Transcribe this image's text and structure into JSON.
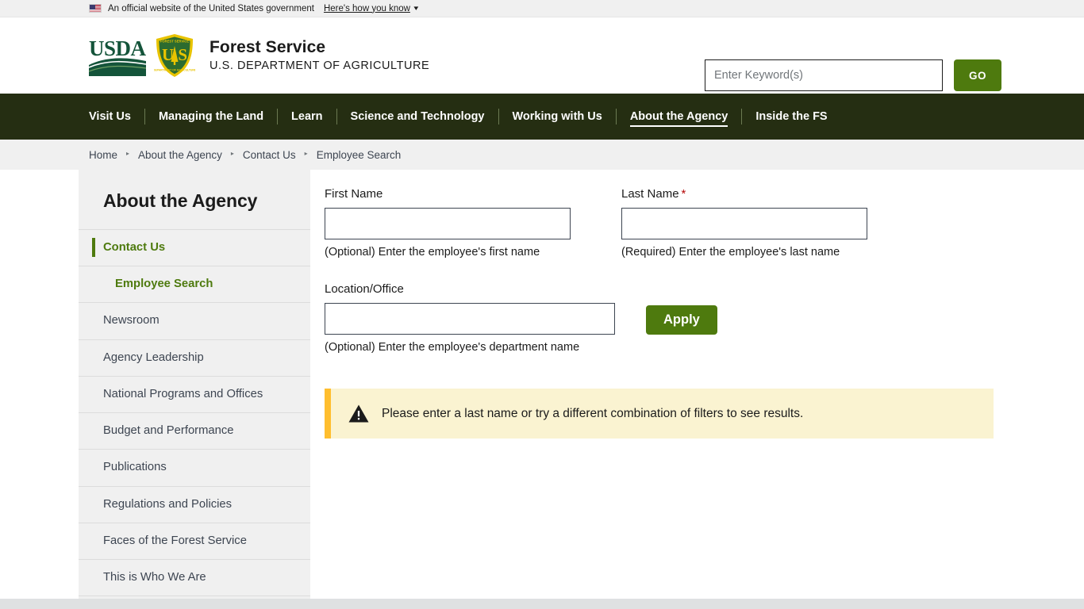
{
  "usa_banner": {
    "text": "An official website of the United States government",
    "link_label": "Here's how you know",
    "flag_icon": "us-flag-icon",
    "caret_icon": "chevron-down-icon"
  },
  "header": {
    "usda_logo": "usda-logo",
    "fs_shield": "forest-service-shield-icon",
    "title": "Forest Service",
    "subtitle": "U.S. DEPARTMENT OF AGRICULTURE",
    "search": {
      "placeholder": "Enter Keyword(s)",
      "value": "",
      "button_label": "GO"
    }
  },
  "nav": {
    "items": [
      {
        "label": "Visit Us",
        "active": false
      },
      {
        "label": "Managing the Land",
        "active": false
      },
      {
        "label": "Learn",
        "active": false
      },
      {
        "label": "Science and Technology",
        "active": false
      },
      {
        "label": "Working with Us",
        "active": false
      },
      {
        "label": "About the Agency",
        "active": true
      },
      {
        "label": "Inside the FS",
        "active": false
      }
    ]
  },
  "breadcrumb": {
    "separator": "▸",
    "items": [
      {
        "label": "Home"
      },
      {
        "label": "About the Agency"
      },
      {
        "label": "Contact Us"
      },
      {
        "label": "Employee Search"
      }
    ]
  },
  "sidebar": {
    "title": "About the Agency",
    "items": [
      {
        "label": "Contact Us",
        "state": "active"
      },
      {
        "label": "Employee Search",
        "state": "sub"
      },
      {
        "label": "Newsroom",
        "state": "normal"
      },
      {
        "label": "Agency Leadership",
        "state": "normal"
      },
      {
        "label": "National Programs and Offices",
        "state": "normal"
      },
      {
        "label": "Budget and Performance",
        "state": "normal"
      },
      {
        "label": "Publications",
        "state": "normal"
      },
      {
        "label": "Regulations and Policies",
        "state": "normal"
      },
      {
        "label": "Faces of the Forest Service",
        "state": "normal"
      },
      {
        "label": "This is Who We Are",
        "state": "normal"
      }
    ]
  },
  "form": {
    "first_name": {
      "label": "First Name",
      "value": "",
      "placeholder": "",
      "hint": "(Optional) Enter the employee's first name"
    },
    "last_name": {
      "label": "Last Name",
      "required_marker": "*",
      "value": "",
      "placeholder": "",
      "hint": "(Required) Enter the employee's last name"
    },
    "location": {
      "label": "Location/Office",
      "value": "",
      "placeholder": "",
      "hint": "(Optional) Enter the employee's department name"
    },
    "apply_label": "Apply"
  },
  "alert": {
    "icon": "warning-triangle-icon",
    "message": "Please enter a last name or try a different combination of filters to see results."
  },
  "colors": {
    "nav_background": "#252e12",
    "accent_green": "#4e7a0e",
    "usda_green": "#14543a",
    "alert_background": "#faf3d1",
    "alert_border": "#ffbe2e",
    "required_red": "#b50909",
    "sidebar_background": "#f0f0f0"
  }
}
